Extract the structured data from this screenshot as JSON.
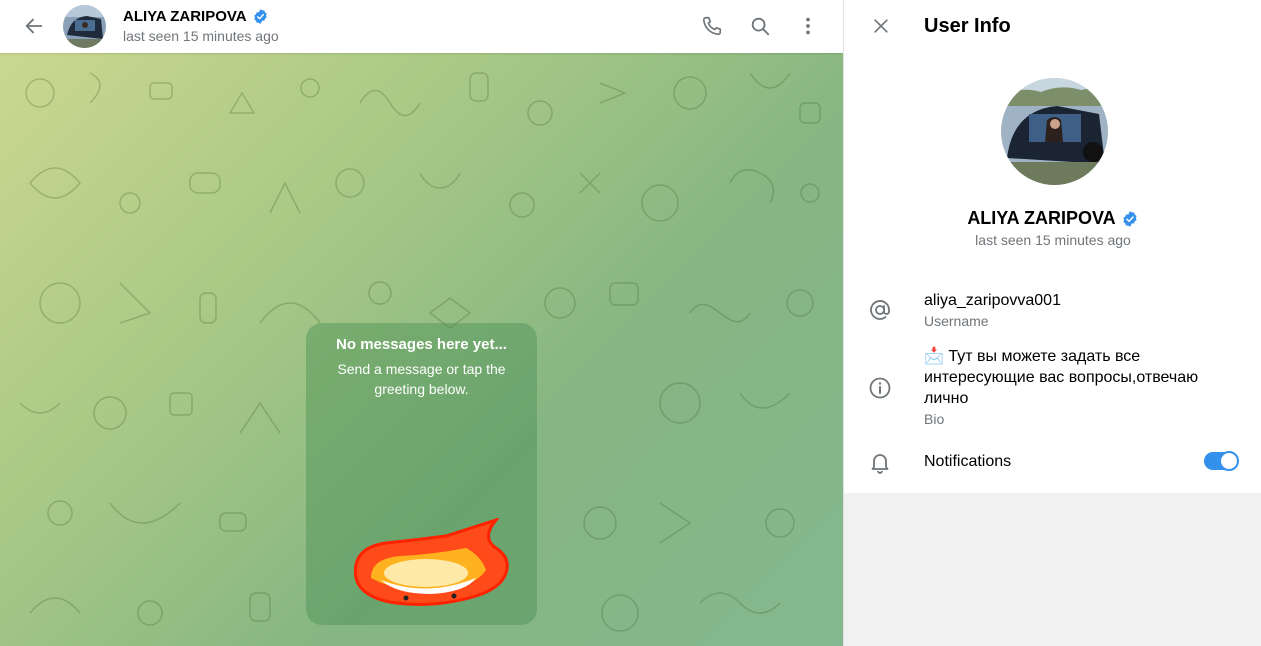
{
  "chat": {
    "header": {
      "name": "ALIYA ZARIPOVA",
      "status": "last seen 15 minutes ago"
    },
    "empty_state": {
      "title": "No messages here yet...",
      "subtitle": "Send a message or tap the greeting below."
    }
  },
  "panel": {
    "title": "User Info",
    "profile": {
      "name": "ALIYA ZARIPOVA",
      "status": "last seen 15 minutes ago"
    },
    "username": {
      "value": "aliya_zaripovva001",
      "label": "Username"
    },
    "bio": {
      "emoji": "📩",
      "value": "Тут вы можете задать все интересующие вас вопросы,отвечаю лично",
      "label": "Bio"
    },
    "notifications": {
      "label": "Notifications",
      "enabled": true
    }
  },
  "colors": {
    "accent": "#3390ec",
    "secondary_text": "#707579"
  }
}
